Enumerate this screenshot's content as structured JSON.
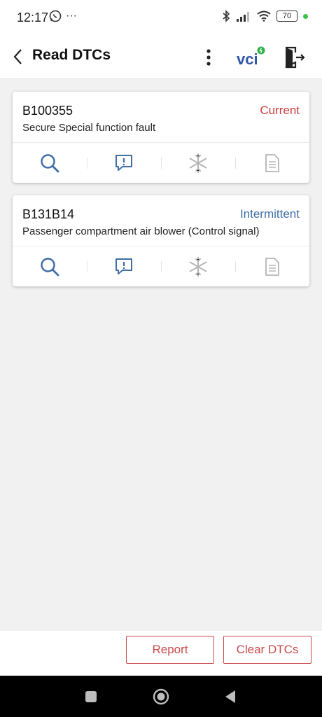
{
  "status_bar": {
    "time": "12:17",
    "dots": "···",
    "battery": "70"
  },
  "app_bar": {
    "title": "Read DTCs",
    "vci_label": "vci"
  },
  "dtcs": [
    {
      "code": "B100355",
      "status": "Current",
      "description": "Secure Special function fault"
    },
    {
      "code": "B131B14",
      "status": "Intermittent",
      "description": "Passenger compartment air blower (Control signal)"
    }
  ],
  "footer": {
    "report_label": "Report",
    "clear_label": "Clear DTCs"
  },
  "colors": {
    "accent_red": "#c84a4a",
    "current": "#d23c3c",
    "intermittent": "#3f6da6",
    "icon_blue": "#3f6da6",
    "icon_grey": "#b5b5b5",
    "vci_blue": "#2f56a6",
    "vci_green": "#2eb14a"
  }
}
